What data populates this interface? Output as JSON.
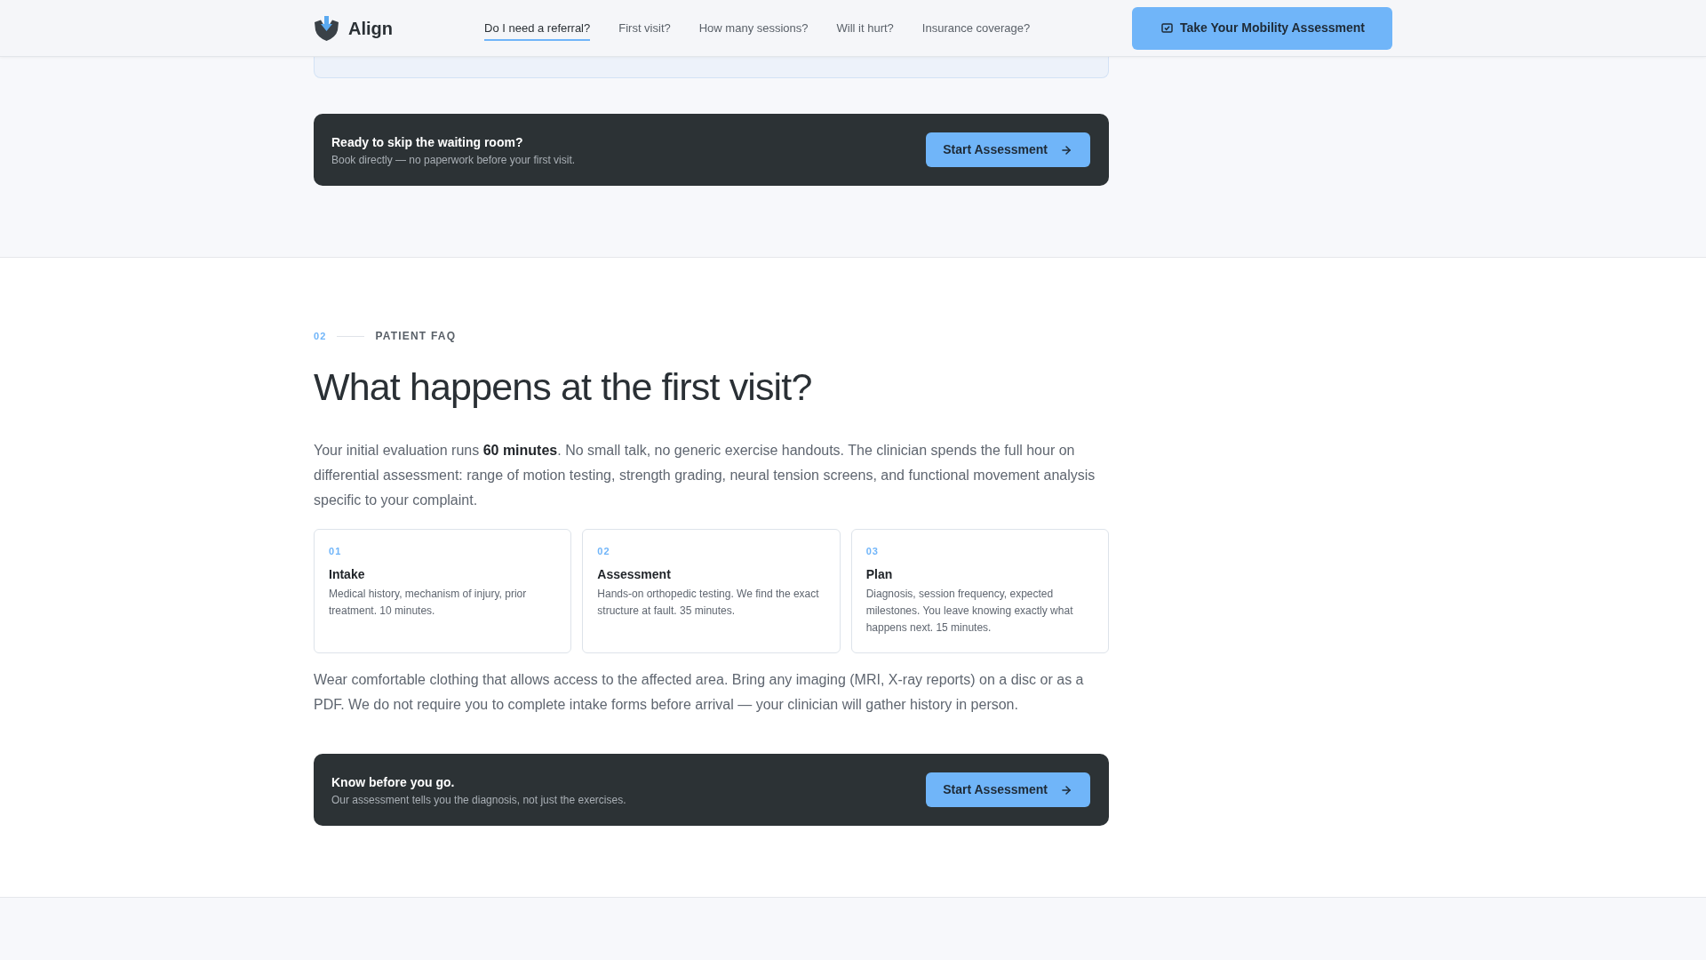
{
  "header": {
    "brand": "Align",
    "nav": [
      {
        "label": "Do I need a referral?",
        "selected": true
      },
      {
        "label": "First visit?",
        "selected": false
      },
      {
        "label": "How many sessions?",
        "selected": false
      },
      {
        "label": "Will it hurt?",
        "selected": false
      },
      {
        "label": "Insurance coverage?",
        "selected": false
      }
    ],
    "cta": "Take Your Mobility Assessment"
  },
  "top_banner": {
    "title": "Ready to skip the waiting room?",
    "subtitle": "Book directly — no paperwork before your first visit.",
    "button": "Start Assessment"
  },
  "section": {
    "number": "02",
    "eyebrow": "PATIENT FAQ",
    "title": "What happens at the first visit?",
    "intro": "Your initial evaluation runs **60 minutes**. No small talk, no generic exercise handouts. The clinician spends the full hour on differential assessment: range of motion testing, strength grading, neural tension screens, and functional movement analysis specific to your complaint.",
    "steps": [
      {
        "number": "01",
        "title": "Intake",
        "text": "Medical history, mechanism of injury, prior treatment. 10 minutes."
      },
      {
        "number": "02",
        "title": "Assessment",
        "text": "Hands-on orthopedic testing. We find the exact structure at fault. 35 minutes."
      },
      {
        "number": "03",
        "title": "Plan",
        "text": "Diagnosis, session frequency, expected milestones. You leave knowing exactly what happens next. 15 minutes."
      }
    ],
    "note": "Wear comfortable clothing that allows access to the affected area. Bring any imaging (MRI, X-ray reports) on a disc or as a PDF. We do not require you to complete intake forms before arrival — your clinician will gather history in person.",
    "banner": {
      "title": "Know before you go.",
      "subtitle": "Our assessment tells you the diagnosis, not just the exercises.",
      "button": "Start Assessment"
    }
  }
}
